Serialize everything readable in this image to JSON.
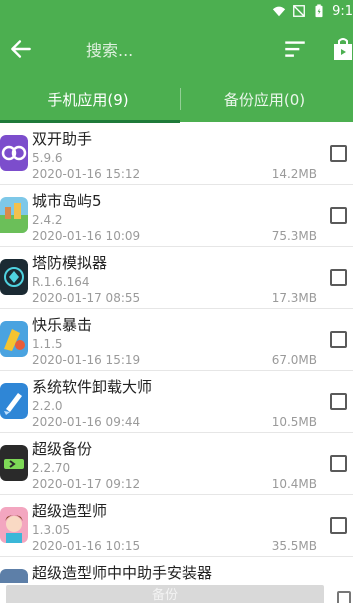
{
  "status": {
    "time": "9:1"
  },
  "toolbar": {
    "search_placeholder": "搜索..."
  },
  "tabs": [
    {
      "label": "手机应用(9)",
      "active": true
    },
    {
      "label": "备份应用(0)",
      "active": false
    }
  ],
  "apps": [
    {
      "name": "双开助手",
      "version": "5.9.6",
      "date": "2020-01-16 15:12",
      "size": "14.2MB",
      "icon": "dual-space-icon"
    },
    {
      "name": "城市岛屿5",
      "version": "2.4.2",
      "date": "2020-01-16 10:09",
      "size": "75.3MB",
      "icon": "city-island-icon"
    },
    {
      "name": "塔防模拟器",
      "version": "R.1.6.164",
      "date": "2020-01-17 08:55",
      "size": "17.3MB",
      "icon": "tower-defense-icon"
    },
    {
      "name": "快乐暴击",
      "version": "1.1.5",
      "date": "2020-01-16 15:19",
      "size": "67.0MB",
      "icon": "happy-crit-icon"
    },
    {
      "name": "系统软件卸载大师",
      "version": "2.2.0",
      "date": "2020-01-16 09:44",
      "size": "10.5MB",
      "icon": "uninstaller-icon"
    },
    {
      "name": "超级备份",
      "version": "2.2.70",
      "date": "2020-01-17 09:12",
      "size": "10.4MB",
      "icon": "super-backup-icon"
    },
    {
      "name": "超级造型师",
      "version": "1.3.05",
      "date": "2020-01-16 10:15",
      "size": "35.5MB",
      "icon": "super-stylist-icon"
    },
    {
      "name": "超级造型师中中助手安装器",
      "version": "",
      "date": "",
      "size": "",
      "icon": "installer-icon"
    }
  ],
  "bottom": {
    "backup_label": "备份"
  },
  "colors": {
    "primary": "#4caf50",
    "indicator": "#1f7a3a"
  }
}
